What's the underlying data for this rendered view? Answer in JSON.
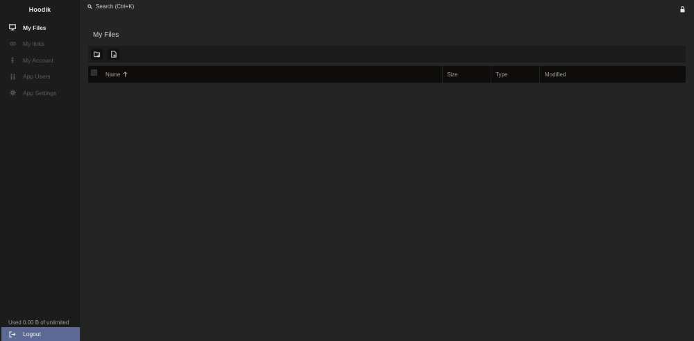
{
  "app": {
    "brand": "Hoodik"
  },
  "sidebar": {
    "items": [
      {
        "label": "My Files",
        "icon": "monitor-icon",
        "active": true
      },
      {
        "label": "My links",
        "icon": "link-icon",
        "active": false
      },
      {
        "label": "My Account",
        "icon": "person-icon",
        "active": false
      },
      {
        "label": "App Users",
        "icon": "users-icon",
        "active": false
      },
      {
        "label": "App Settings",
        "icon": "gear-icon",
        "active": false
      }
    ],
    "usage": "Used 0.00 B of unlimited",
    "logout_label": "Logout"
  },
  "topbar": {
    "search_label": "Search (Ctrl+K)",
    "lock_icon": "lock-icon"
  },
  "main": {
    "title": "My Files",
    "toolbar": {
      "buttons": [
        {
          "name": "new-folder",
          "icon": "folder-plus-icon"
        },
        {
          "name": "new-file",
          "icon": "file-plus-icon"
        }
      ]
    },
    "table": {
      "columns": [
        "Name",
        "Size",
        "Type",
        "Modified"
      ],
      "sort_column": "Name",
      "sort_direction": "ascending",
      "rows": []
    }
  },
  "colors": {
    "background": "#242424",
    "sidebar": "#1c1c1c",
    "accent": "#5b6b95",
    "table_header": "#0f0d0b"
  }
}
